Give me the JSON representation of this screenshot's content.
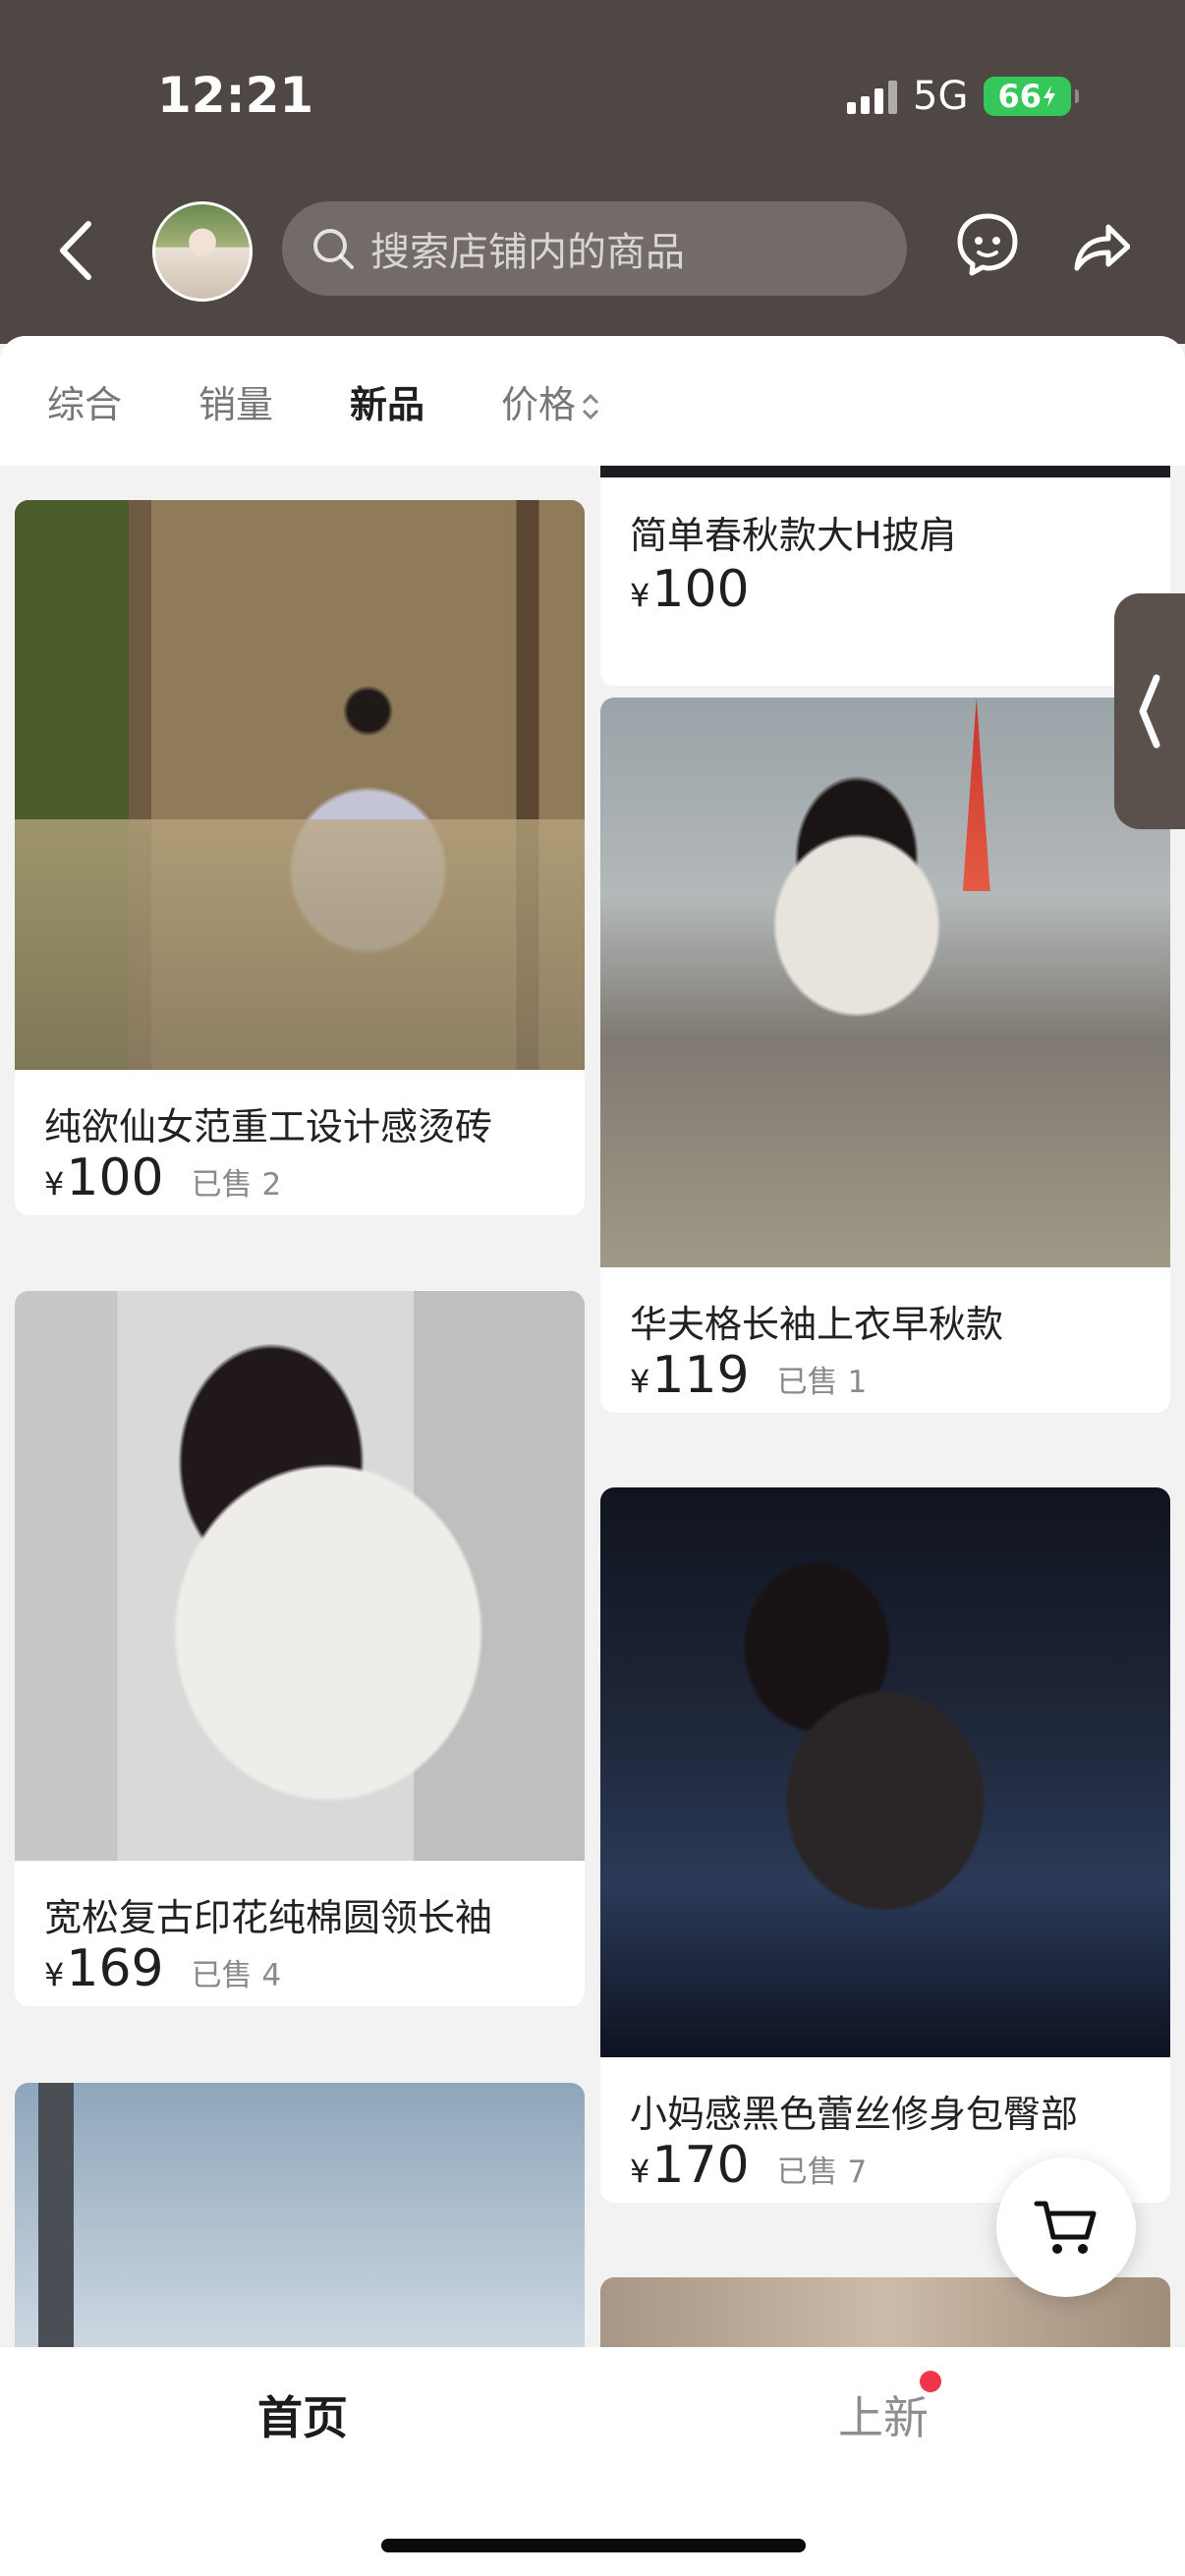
{
  "status_bar": {
    "time": "12:21",
    "network": "5G",
    "battery": "66"
  },
  "header": {
    "search_placeholder": "搜索店铺内的商品"
  },
  "tabs": [
    {
      "label": "综合",
      "active": false
    },
    {
      "label": "销量",
      "active": false
    },
    {
      "label": "新品",
      "active": true
    },
    {
      "label": "价格",
      "active": false
    }
  ],
  "products": {
    "left": [
      {
        "title": "纯欲仙女范重工设计感烫砖",
        "yen": "¥",
        "price": "100",
        "sold": "已售 2"
      },
      {
        "title": "宽松复古印花纯棉圆领长袖",
        "yen": "¥",
        "price": "169",
        "sold": "已售 4"
      }
    ],
    "right": [
      {
        "title": "简单春秋款大H披肩",
        "yen": "¥",
        "price": "100",
        "sold": ""
      },
      {
        "title": "华夫格长袖上衣早秋款",
        "yen": "¥",
        "price": "119",
        "sold": "已售 1"
      },
      {
        "title": "小妈感黑色蕾丝修身包臀部",
        "yen": "¥",
        "price": "170",
        "sold": "已售 7"
      }
    ]
  },
  "bottom_nav": {
    "home": "首页",
    "new": "上新"
  },
  "colors": {
    "header_bg": "#4f4743",
    "accent_red": "#f0344a",
    "battery_green": "#35c759"
  }
}
